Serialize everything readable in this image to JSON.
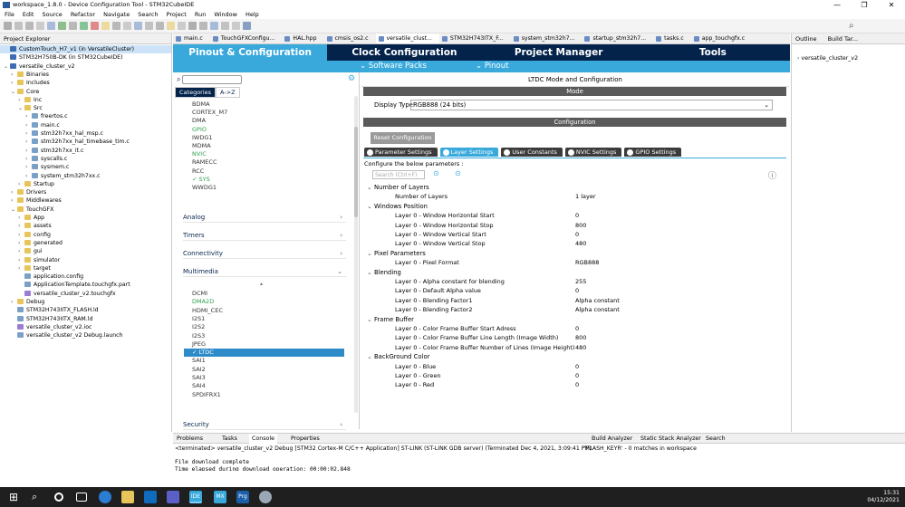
{
  "window": {
    "title": "workspace_1.8.0 - Device Configuration Tool - STM32CubeIDE",
    "controls": [
      "—",
      "❐",
      "✕"
    ]
  },
  "menu": [
    "File",
    "Edit",
    "Source",
    "Refactor",
    "Navigate",
    "Search",
    "Project",
    "Run",
    "Window",
    "Help"
  ],
  "left": {
    "tab_label": "Project Explorer",
    "rows": [
      {
        "label": "CustomTouch_H7_v1 (in VersatileCluster)",
        "indent": 0,
        "icon": "proj",
        "tw": "",
        "sel": true
      },
      {
        "label": "STM32H750B-DK (in STM32CubeIDE)",
        "indent": 0,
        "icon": "proj",
        "tw": ""
      },
      {
        "label": "versatile_cluster_v2",
        "indent": 0,
        "icon": "proj",
        "tw": "⌄"
      },
      {
        "label": "Binaries",
        "indent": 1,
        "icon": "fold",
        "tw": "›"
      },
      {
        "label": "Includes",
        "indent": 1,
        "icon": "fold",
        "tw": "›"
      },
      {
        "label": "Core",
        "indent": 1,
        "icon": "fold",
        "tw": "⌄"
      },
      {
        "label": "Inc",
        "indent": 2,
        "icon": "fold",
        "tw": "›"
      },
      {
        "label": "Src",
        "indent": 2,
        "icon": "fold",
        "tw": "⌄"
      },
      {
        "label": "freertos.c",
        "indent": 3,
        "icon": "file",
        "tw": "›"
      },
      {
        "label": "main.c",
        "indent": 3,
        "icon": "file",
        "tw": "›"
      },
      {
        "label": "stm32h7xx_hal_msp.c",
        "indent": 3,
        "icon": "file",
        "tw": "›"
      },
      {
        "label": "stm32h7xx_hal_timebase_tim.c",
        "indent": 3,
        "icon": "file",
        "tw": "›"
      },
      {
        "label": "stm32h7xx_it.c",
        "indent": 3,
        "icon": "file",
        "tw": "›"
      },
      {
        "label": "syscalls.c",
        "indent": 3,
        "icon": "file",
        "tw": "›"
      },
      {
        "label": "sysmem.c",
        "indent": 3,
        "icon": "file",
        "tw": "›"
      },
      {
        "label": "system_stm32h7xx.c",
        "indent": 3,
        "icon": "file",
        "tw": "›"
      },
      {
        "label": "Startup",
        "indent": 2,
        "icon": "fold",
        "tw": "›"
      },
      {
        "label": "Drivers",
        "indent": 1,
        "icon": "fold",
        "tw": "›"
      },
      {
        "label": "Middlewares",
        "indent": 1,
        "icon": "fold",
        "tw": "›"
      },
      {
        "label": "TouchGFX",
        "indent": 1,
        "icon": "fold",
        "tw": "⌄"
      },
      {
        "label": "App",
        "indent": 2,
        "icon": "fold",
        "tw": "›"
      },
      {
        "label": "assets",
        "indent": 2,
        "icon": "fold",
        "tw": "›"
      },
      {
        "label": "config",
        "indent": 2,
        "icon": "fold",
        "tw": "›"
      },
      {
        "label": "generated",
        "indent": 2,
        "icon": "fold",
        "tw": "›"
      },
      {
        "label": "gui",
        "indent": 2,
        "icon": "fold",
        "tw": "›"
      },
      {
        "label": "simulator",
        "indent": 2,
        "icon": "fold",
        "tw": "›"
      },
      {
        "label": "target",
        "indent": 2,
        "icon": "fold",
        "tw": "›"
      },
      {
        "label": "application.config",
        "indent": 2,
        "icon": "file",
        "tw": ""
      },
      {
        "label": "ApplicationTemplate.touchgfx.part",
        "indent": 2,
        "icon": "file",
        "tw": ""
      },
      {
        "label": "versatile_cluster_v2.touchgfx",
        "indent": 2,
        "icon": "pkg",
        "tw": ""
      },
      {
        "label": "Debug",
        "indent": 1,
        "icon": "fold",
        "tw": "›"
      },
      {
        "label": "STM32H743IITX_FLASH.ld",
        "indent": 1,
        "icon": "file",
        "tw": ""
      },
      {
        "label": "STM32H743IITX_RAM.ld",
        "indent": 1,
        "icon": "file",
        "tw": ""
      },
      {
        "label": "versatile_cluster_v2.ioc",
        "indent": 1,
        "icon": "pkg",
        "tw": ""
      },
      {
        "label": "versatile_cluster_v2 Debug.launch",
        "indent": 1,
        "icon": "file",
        "tw": ""
      }
    ]
  },
  "editor_tabs": [
    "main.c",
    "TouchGFXConfigu...",
    "HAL.hpp",
    "cmsis_os2.c",
    "versatile_clust...",
    "STM32H743ITX_F...",
    "system_stm32h7...",
    "startup_stm32h7...",
    "tasks.c",
    "app_touchgfx.c"
  ],
  "cube_tabs": [
    "Pinout & Configuration",
    "Clock Configuration",
    "Project Manager",
    "Tools"
  ],
  "sub_tabs": [
    "⌄ Software Packs",
    "⌄ Pinout"
  ],
  "categories": {
    "tabs": [
      "Categories",
      "A->Z"
    ],
    "system": [
      {
        "l": "BDMA",
        "c": ""
      },
      {
        "l": "CORTEX_M7",
        "c": ""
      },
      {
        "l": "DMA",
        "c": ""
      },
      {
        "l": "GPIO",
        "c": "green"
      },
      {
        "l": "IWDG1",
        "c": ""
      },
      {
        "l": "MDMA",
        "c": ""
      },
      {
        "l": "NVIC",
        "c": "green"
      },
      {
        "l": "RAMECC",
        "c": ""
      },
      {
        "l": "RCC",
        "c": ""
      },
      {
        "l": "✓ SYS",
        "c": "green"
      },
      {
        "l": "WWDG1",
        "c": ""
      }
    ],
    "groups": [
      "Analog",
      "Timers",
      "Connectivity",
      "Multimedia",
      "Security"
    ],
    "multimedia": [
      {
        "l": "DCMI",
        "c": ""
      },
      {
        "l": "DMA2D",
        "c": "green"
      },
      {
        "l": "HDMI_CEC",
        "c": ""
      },
      {
        "l": "I2S1",
        "c": ""
      },
      {
        "l": "I2S2",
        "c": ""
      },
      {
        "l": "I2S3",
        "c": ""
      },
      {
        "l": "JPEG",
        "c": ""
      },
      {
        "l": "✓ LTDC",
        "c": "sel"
      },
      {
        "l": "SAI1",
        "c": ""
      },
      {
        "l": "SAI2",
        "c": ""
      },
      {
        "l": "SAI3",
        "c": ""
      },
      {
        "l": "SAI4",
        "c": ""
      },
      {
        "l": "SPDIFRX1",
        "c": ""
      }
    ]
  },
  "config": {
    "header": "LTDC Mode and Configuration",
    "mode_bar": "Mode",
    "display_type_label": "Display Type",
    "display_type_value": "RGB888 (24 bits)",
    "config_bar": "Configuration",
    "reset_btn": "Reset Configuration",
    "tabs": [
      "Parameter Settings",
      "Layer Settings",
      "User Constants",
      "NVIC Settings",
      "GPIO Settings"
    ],
    "hint": "Configure the below parameters :",
    "search_placeholder": "Search (Ctrl+F)",
    "groups": [
      {
        "name": "Number of Layers",
        "items": [
          [
            "Number of Layers",
            "1 layer"
          ]
        ]
      },
      {
        "name": "Windows Position",
        "items": [
          [
            "Layer 0 - Window Horizontal Start",
            "0"
          ],
          [
            "Layer 0 - Window Horizontal Stop",
            "800"
          ],
          [
            "Layer 0 - Window Vertical Start",
            "0"
          ],
          [
            "Layer 0 - Window Vertical Stop",
            "480"
          ]
        ]
      },
      {
        "name": "Pixel Parameters",
        "items": [
          [
            "Layer 0 - Pixel Format",
            "RGB888"
          ]
        ]
      },
      {
        "name": "Blending",
        "items": [
          [
            "Layer 0 - Alpha constant for blending",
            "255"
          ],
          [
            "Layer 0 - Default Alpha value",
            "0"
          ],
          [
            "Layer 0 - Blending Factor1",
            "Alpha constant"
          ],
          [
            "Layer 0 - Blending Factor2",
            "Alpha constant"
          ]
        ]
      },
      {
        "name": "Frame Buffer",
        "items": [
          [
            "Layer 0 - Color Frame Buffer Start Adress",
            "0"
          ],
          [
            "Layer 0 - Color Frame Buffer Line Length (Image Width)",
            "800"
          ],
          [
            "Layer 0 - Color Frame Buffer Number of Lines (Image Height)",
            "480"
          ]
        ]
      },
      {
        "name": "BackGround Color",
        "items": [
          [
            "Layer 0 - Blue",
            "0"
          ],
          [
            "Layer 0 - Green",
            "0"
          ],
          [
            "Layer 0 - Red",
            "0"
          ]
        ]
      }
    ]
  },
  "outline": {
    "tabs": [
      "Outline",
      "Build Tar..."
    ],
    "item": "versatile_cluster_v2"
  },
  "bottom": {
    "tabs": [
      "Problems",
      "Tasks",
      "Console",
      "Properties"
    ],
    "right_tabs": [
      "Build Analyzer",
      "Static Stack Analyzer",
      "Search"
    ],
    "terminated": "<terminated> versatile_cluster_v2 Debug [STM32 Cortex-M C/C++ Application] ST-LINK (ST-LINK GDB server) (Terminated Dec 4, 2021, 3:09:41 PM)",
    "search_result": "'FLASH_KEYR' - 0 matches in workspace",
    "line1": "File download complete",
    "line2": "Time elapsed during download operation: 00:00:02.848"
  },
  "taskbar": {
    "time": "15:31",
    "date": "04/12/2021"
  }
}
